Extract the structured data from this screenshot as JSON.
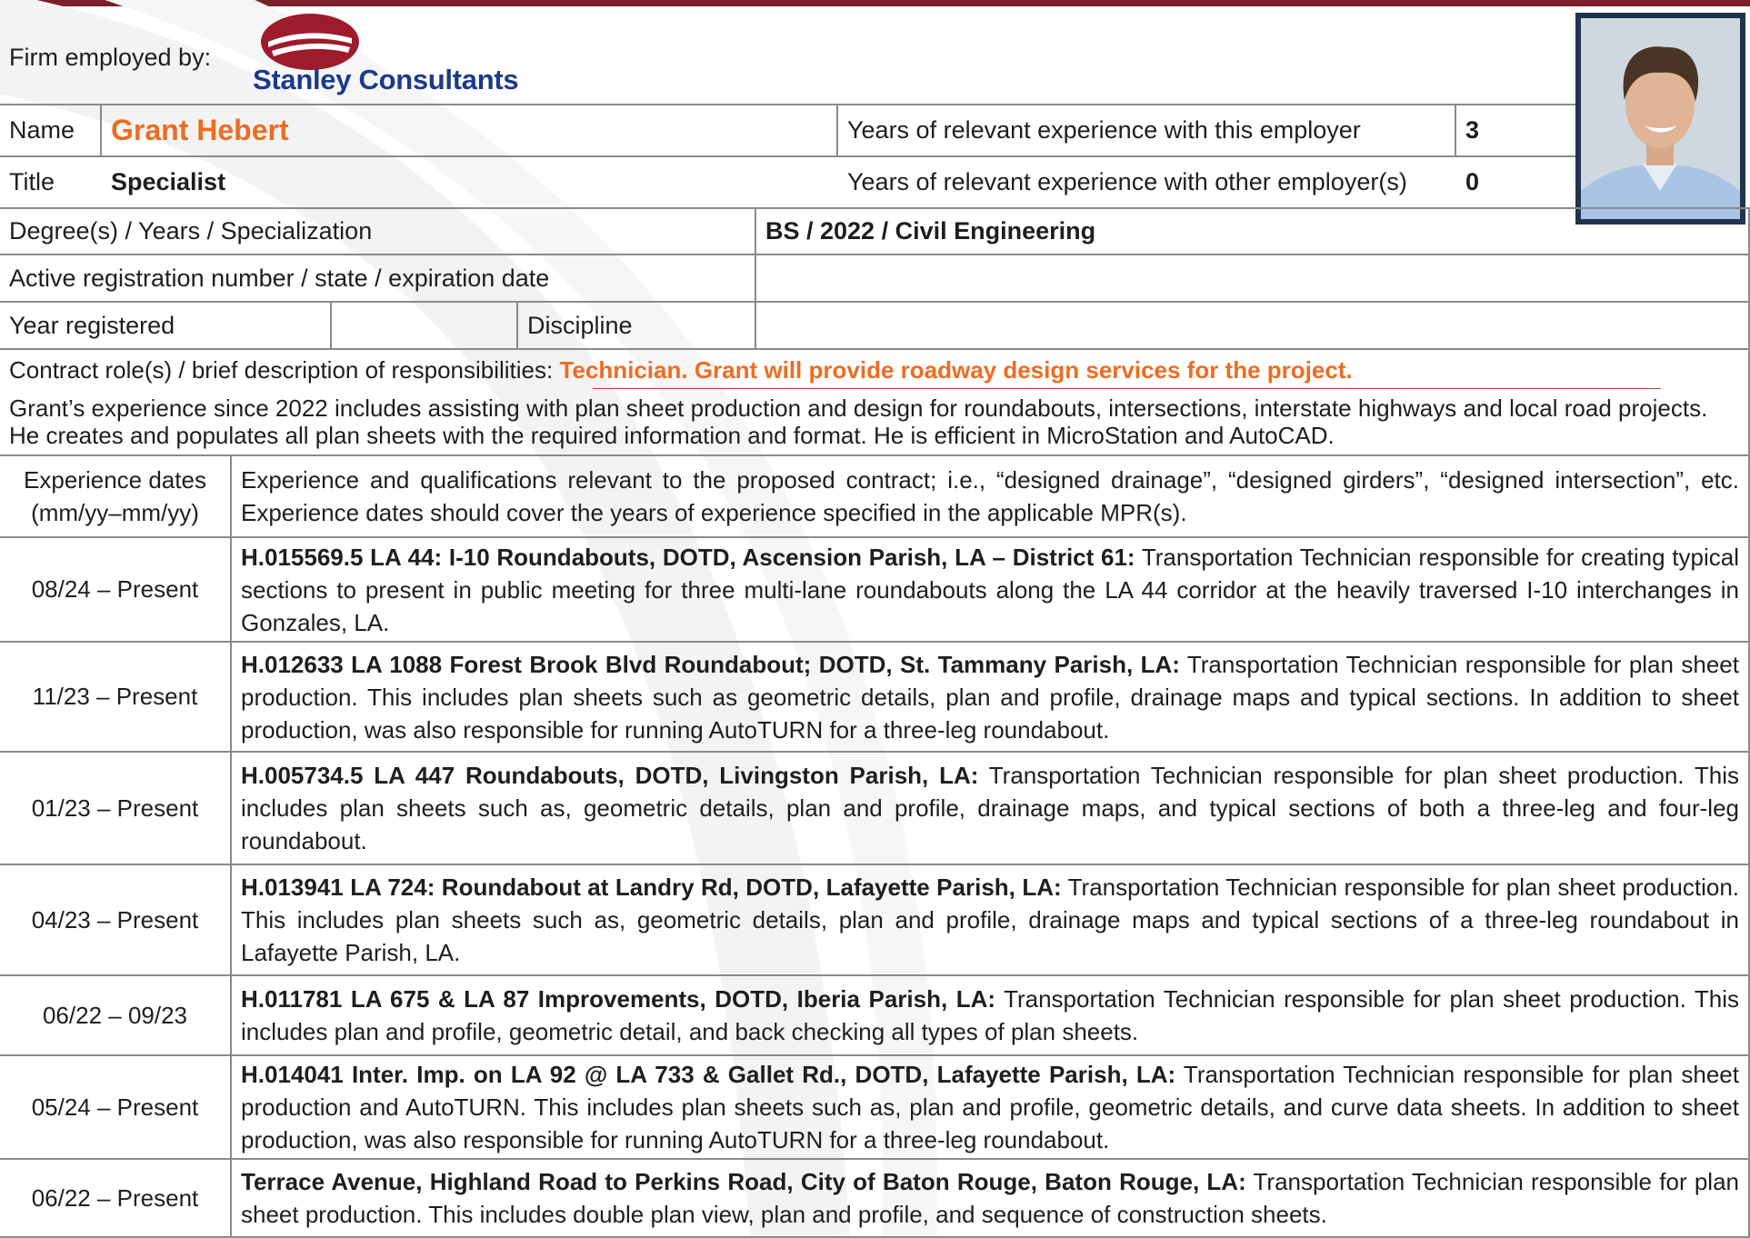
{
  "firm": {
    "label": "Firm employed by:",
    "logo_text": "Stanley Consultants",
    "logo_mark": "®"
  },
  "person": {
    "name_label": "Name",
    "name": "Grant Hebert",
    "title_label": "Title",
    "title": "Specialist",
    "years_this_label": "Years of relevant experience with this employer",
    "years_this": "3",
    "years_other_label": "Years of relevant experience with other employer(s)",
    "years_other": "0"
  },
  "degree": {
    "label": "Degree(s) / Years / Specialization",
    "value": "BS / 2022 / Civil Engineering"
  },
  "registration": {
    "label": "Active registration number / state / expiration date",
    "value": ""
  },
  "year_registered": {
    "label": "Year registered",
    "value": "",
    "discipline_label": "Discipline",
    "discipline_value": ""
  },
  "contract_role": {
    "label": "Contract role(s) / brief description of responsibilities:",
    "value": "Technician. Grant will provide roadway design services for the project."
  },
  "summary": "Grant’s experience since 2022 includes assisting with plan sheet production and design for roundabouts, intersections, interstate highways and local road projects. He creates and populates all plan sheets with the required information and format. He is efficient in MicroStation and AutoCAD.",
  "experience_header": {
    "dates_line1": "Experience dates",
    "dates_line2": "(mm/yy–mm/yy)",
    "description": "Experience and qualifications relevant to the proposed contract; i.e., “designed drainage”, “designed girders”, “designed intersection”, etc.  Experience dates should cover the years of experience specified in the applicable MPR(s)."
  },
  "experience": [
    {
      "dates": "08/24 – Present",
      "project": "H.015569.5 LA 44: I-10 Roundabouts, DOTD, Ascension Parish, LA – District 61:",
      "text": " Transportation Technician responsible for creating typical sections to present in public meeting for three multi-lane roundabouts along the LA 44 corridor at the heavily traversed I-10 interchanges in Gonzales, LA."
    },
    {
      "dates": "11/23 – Present",
      "project": "H.012633 LA 1088 Forest Brook Blvd Roundabout; DOTD, St. Tammany Parish, LA:",
      "text": " Transportation Technician responsible for plan sheet production. This includes plan sheets such as geometric details, plan and profile, drainage maps and typical sections. In addition to sheet production, was also responsible for running AutoTURN for a three-leg roundabout."
    },
    {
      "dates": "01/23 – Present",
      "project": "H.005734.5 LA 447 Roundabouts, DOTD, Livingston Parish, LA:",
      "text": " Transportation Technician responsible for plan sheet production. This includes plan sheets such as, geometric details, plan and profile, drainage maps, and typical sections of both a three-leg and four-leg roundabout."
    },
    {
      "dates": "04/23 – Present",
      "project": "H.013941 LA 724: Roundabout at Landry Rd, DOTD, Lafayette Parish, LA:",
      "text": " Transportation Technician responsible for plan sheet production. This includes plan sheets such as, geometric details, plan and profile, drainage maps and typical sections of a three-leg roundabout in Lafayette Parish, LA."
    },
    {
      "dates": "06/22 – 09/23",
      "project": "H.011781 LA 675 & LA 87 Improvements, DOTD, Iberia Parish, LA:",
      "text": " Transportation Technician responsible for plan sheet production. This includes plan and profile, geometric detail, and back checking all types of plan sheets."
    },
    {
      "dates": "05/24 – Present",
      "project": "H.014041 Inter. Imp. on LA 92 @ LA 733 & Gallet Rd., DOTD, Lafayette Parish, LA:",
      "text": " Transportation Technician responsible for plan sheet production and AutoTURN. This includes plan sheets such as, plan and profile, geometric details, and curve data sheets. In addition to sheet production, was also responsible for running AutoTURN for a three-leg roundabout."
    },
    {
      "dates": "06/22 – Present",
      "project": "Terrace Avenue, Highland Road to Perkins Road, City of Baton Rouge, Baton Rouge, LA:",
      "text": " Transportation Technician responsible for plan sheet production. This includes double plan view, plan and profile, and sequence of construction sheets."
    }
  ],
  "colors": {
    "brand_red": "#7a1f2b",
    "accent_orange": "#ee6c22",
    "logo_blue": "#1a3a8a",
    "photo_frame": "#22344d"
  }
}
